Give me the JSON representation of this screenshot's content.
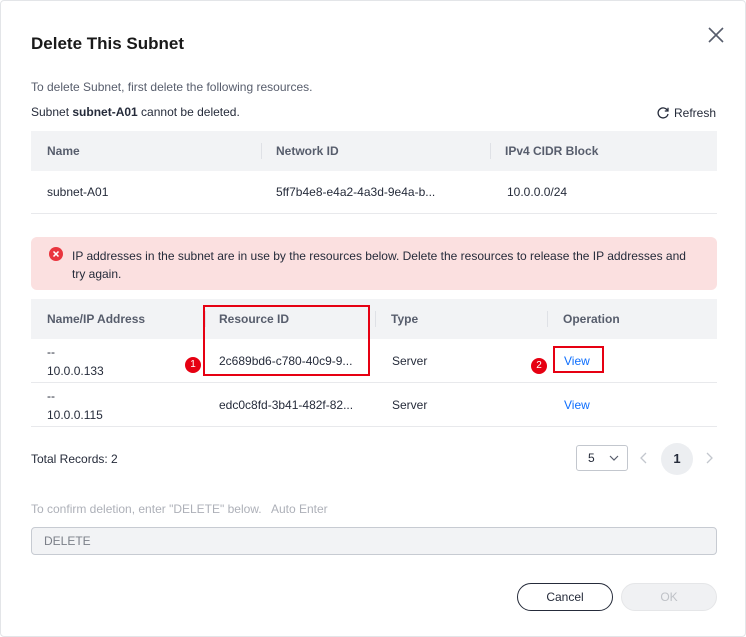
{
  "dialog": {
    "title": "Delete This Subnet",
    "intro": "To delete Subnet, first delete the following resources.",
    "warning_prefix": "Subnet ",
    "subnet_name": "subnet-A01",
    "warning_suffix": " cannot be deleted.",
    "refresh_label": "Refresh"
  },
  "subnet_table": {
    "headers": [
      "Name",
      "Network ID",
      "IPv4 CIDR Block"
    ],
    "rows": [
      [
        "subnet-A01",
        "5ff7b4e8-e4a2-4a3d-9e4a-b...",
        "10.0.0.0/24"
      ]
    ]
  },
  "alert": {
    "text": "IP addresses in the subnet are in use by the resources below. Delete the resources to release the IP addresses and try again."
  },
  "resource_table": {
    "headers": [
      "Name/IP Address",
      "Resource ID",
      "Type",
      "Operation"
    ],
    "rows": [
      {
        "name": "--",
        "ip": "10.0.0.133",
        "resource_id": "2c689bd6-c780-40c9-9...",
        "type": "Server",
        "operation": "View"
      },
      {
        "name": "--",
        "ip": "10.0.0.115",
        "resource_id": "edc0c8fd-3b41-482f-82...",
        "type": "Server",
        "operation": "View"
      }
    ]
  },
  "annotations": [
    "1",
    "2"
  ],
  "pagination": {
    "total": "Total Records: 2",
    "page_size": "5",
    "current_page": "1"
  },
  "confirm": {
    "label": "To confirm deletion, enter \"DELETE\" below.   Auto Enter",
    "value": "DELETE"
  },
  "buttons": {
    "cancel": "Cancel",
    "ok": "OK"
  },
  "colors": {
    "link": "#0d6efd",
    "highlight": "#e60012",
    "alert_bg": "#fbe0e0"
  }
}
